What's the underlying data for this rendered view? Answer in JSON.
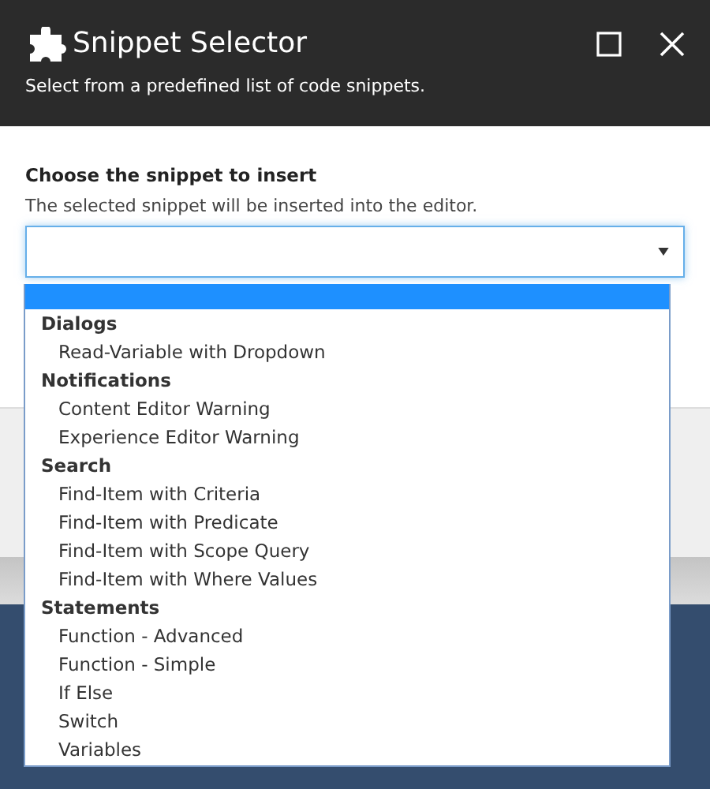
{
  "window": {
    "title": "Snippet Selector",
    "subtitle": "Select from a predefined list of code snippets."
  },
  "field": {
    "label": "Choose the snippet to insert",
    "description": "The selected snippet will be inserted into the editor.",
    "expanded": true
  },
  "dropdown": {
    "blank_option_selected": true,
    "groups": [
      {
        "label": "Dialogs",
        "options": [
          {
            "label": "Read-Variable with Dropdown",
            "selected": false
          }
        ]
      },
      {
        "label": "Notifications",
        "options": [
          {
            "label": "Content Editor Warning",
            "selected": false
          },
          {
            "label": "Experience Editor Warning",
            "selected": false
          }
        ]
      },
      {
        "label": "Search",
        "options": [
          {
            "label": "Find-Item with Criteria",
            "selected": false
          },
          {
            "label": "Find-Item with Predicate",
            "selected": false
          },
          {
            "label": "Find-Item with Scope Query",
            "selected": false
          },
          {
            "label": "Find-Item with Where Values",
            "selected": false
          }
        ]
      },
      {
        "label": "Statements",
        "options": [
          {
            "label": "Function - Advanced",
            "selected": false
          },
          {
            "label": "Function - Simple",
            "selected": false
          },
          {
            "label": "If Else",
            "selected": false
          },
          {
            "label": "Switch",
            "selected": false
          },
          {
            "label": "Variables",
            "selected": false
          }
        ]
      }
    ]
  }
}
